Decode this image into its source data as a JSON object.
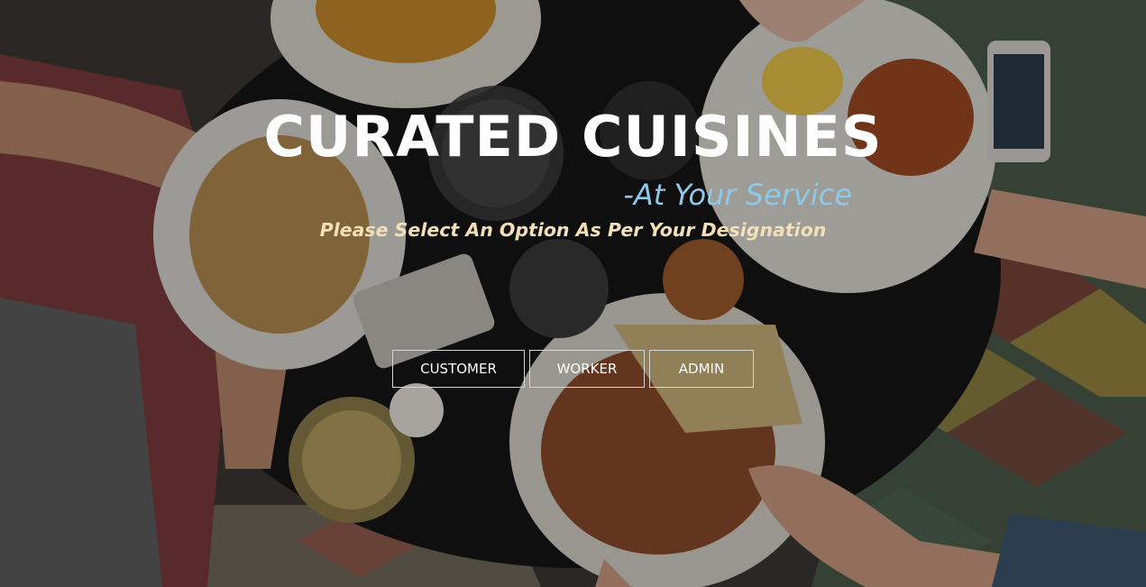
{
  "hero": {
    "title": "CURATED CUISINES",
    "tagline": "-At Your Service",
    "subtitle": "Please Select An Option As Per Your Designation"
  },
  "options": {
    "customer_label": "CUSTOMER",
    "worker_label": "WORKER",
    "admin_label": "ADMIN"
  },
  "colors": {
    "title": "#ffffff",
    "tagline": "#8ec9ea",
    "subtitle": "#f3dfb8",
    "button_border": "#d6d6d6"
  }
}
